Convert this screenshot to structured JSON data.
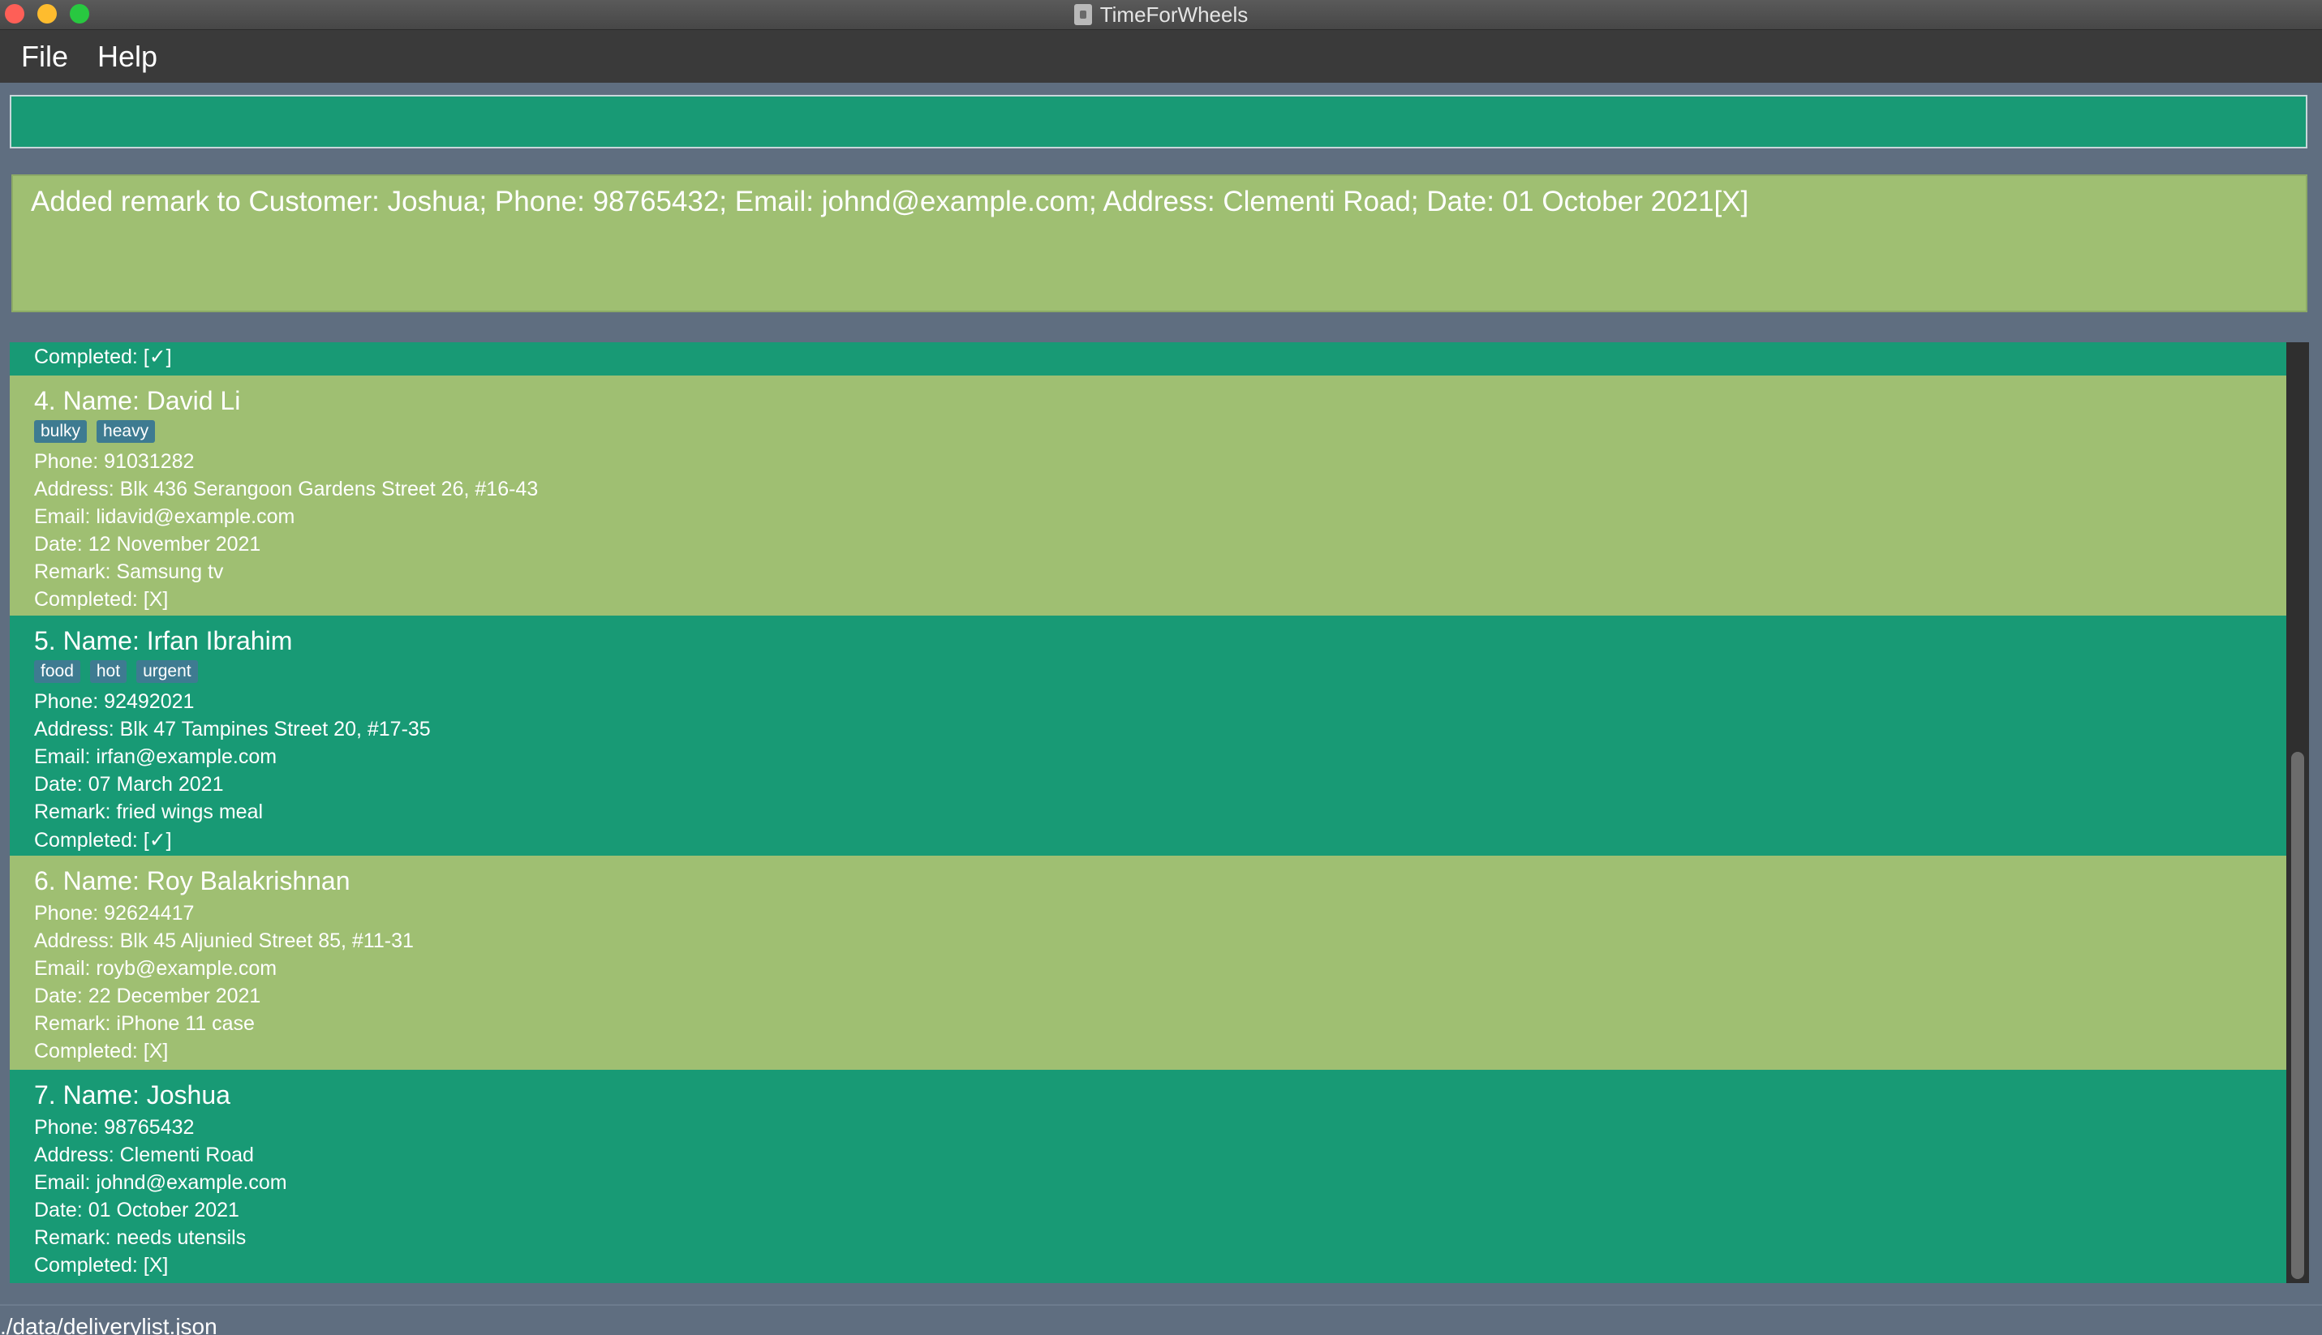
{
  "window": {
    "title": "TimeForWheels"
  },
  "menu": {
    "file_label": "File",
    "help_label": "Help"
  },
  "command": {
    "value": ""
  },
  "result": {
    "message": "Added remark to Customer: Joshua; Phone: 98765432; Email: johnd@example.com; Address: Clementi Road; Date: 01 October 2021[X]"
  },
  "list": {
    "partial_item": {
      "completed": "Completed: [✓]"
    },
    "items": [
      {
        "title": "4.  Name: David Li",
        "tags": [
          "bulky",
          "heavy"
        ],
        "phone": "Phone: 91031282",
        "address": "Address: Blk 436 Serangoon Gardens Street 26, #16-43",
        "email": "Email: lidavid@example.com",
        "date": "Date: 12 November 2021",
        "remark": "Remark: Samsung tv",
        "completed": "Completed: [X]"
      },
      {
        "title": "5.  Name: Irfan Ibrahim",
        "tags": [
          "food",
          "hot",
          "urgent"
        ],
        "phone": "Phone: 92492021",
        "address": "Address: Blk 47 Tampines Street 20, #17-35",
        "email": "Email: irfan@example.com",
        "date": "Date: 07 March 2021",
        "remark": "Remark: fried wings meal",
        "completed": "Completed: [✓]"
      },
      {
        "title": "6.  Name: Roy Balakrishnan",
        "tags": [],
        "phone": "Phone: 92624417",
        "address": "Address: Blk 45 Aljunied Street 85, #11-31",
        "email": "Email: royb@example.com",
        "date": "Date: 22 December 2021",
        "remark": "Remark: iPhone 11 case",
        "completed": "Completed: [X]"
      },
      {
        "title": "7.  Name: Joshua",
        "tags": [],
        "phone": "Phone: 98765432",
        "address": "Address: Clementi Road",
        "email": "Email: johnd@example.com",
        "date": "Date: 01 October 2021",
        "remark": "Remark: needs utensils",
        "completed": "Completed: [X]"
      }
    ]
  },
  "status": {
    "file_path": "./data/deliverylist.json"
  },
  "colors": {
    "dark_card": "#189a75",
    "light_card": "#9fbf72",
    "tag": "#3e7b91",
    "background": "#5f6e80"
  }
}
